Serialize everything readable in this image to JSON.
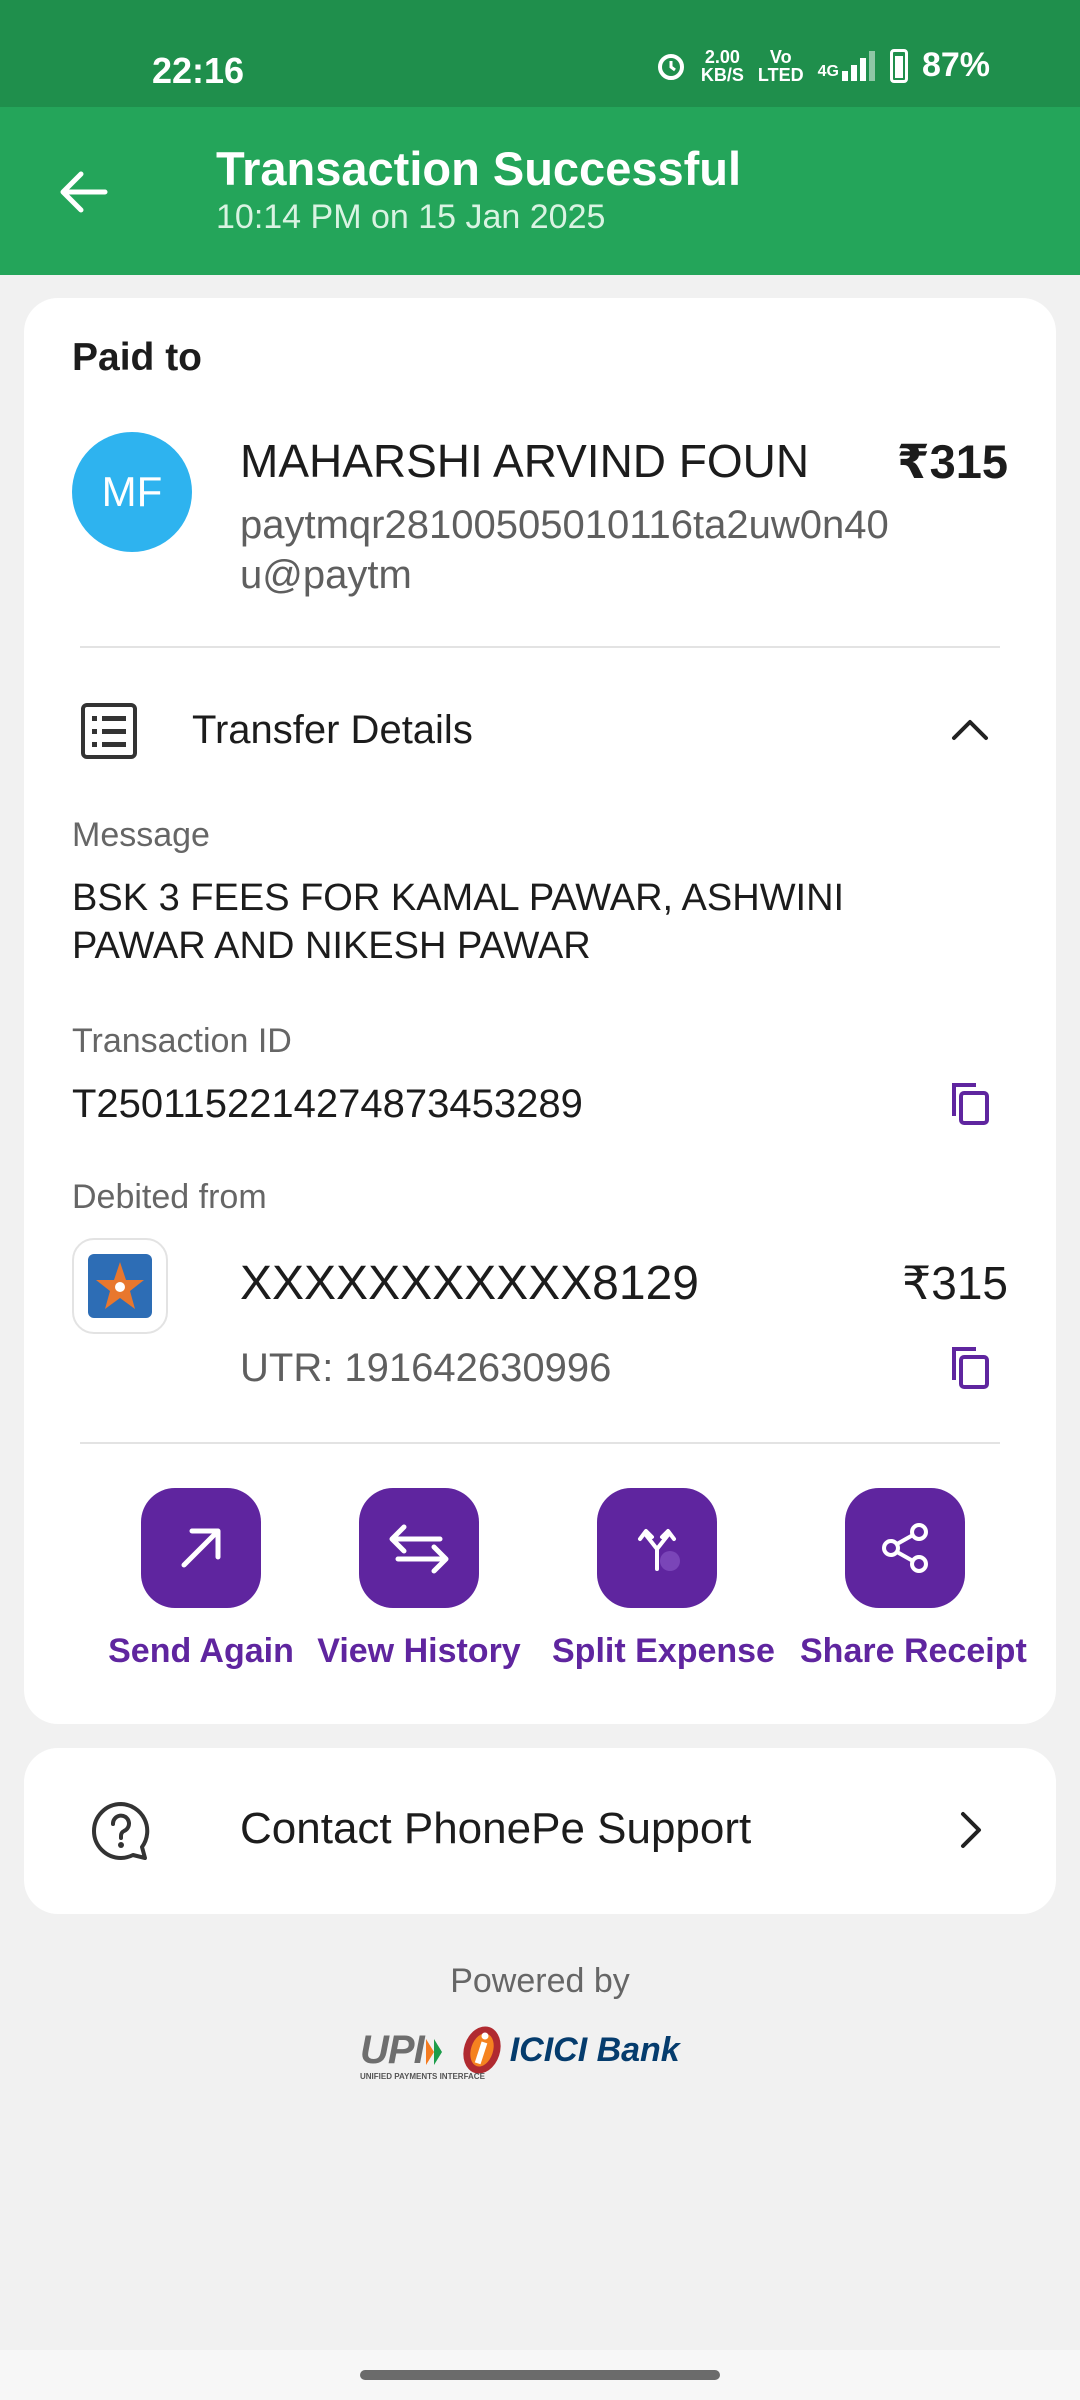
{
  "status_bar": {
    "time": "22:16",
    "net_speed_top": "2.00",
    "net_speed_bottom": "KB/S",
    "volte_top": "Vo",
    "volte_bottom": "LTED",
    "network": "4G",
    "battery": "87%"
  },
  "header": {
    "title": "Transaction Successful",
    "subtitle": "10:14 PM on 15 Jan 2025",
    "back_icon": "arrow-left-icon"
  },
  "payee": {
    "section_label": "Paid to",
    "initials": "MF",
    "name": "MAHARSHI ARVIND FOUN",
    "amount": "₹315",
    "vpa": "paytmqr28100505010116ta2uw0n40u@paytm"
  },
  "transfer_details": {
    "label": "Transfer Details",
    "message_label": "Message",
    "message": "BSK 3 FEES FOR KAMAL PAWAR, ASHWINI PAWAR AND NIKESH PAWAR",
    "txn_id_label": "Transaction ID",
    "txn_id": "T2501152214274873453289",
    "debited_label": "Debited from",
    "account": "XXXXXXXXXXX8129",
    "debit_amount": "₹315",
    "utr": "UTR: 191642630996"
  },
  "actions": [
    {
      "label": "Send Again",
      "icon": "arrow-up-right-icon"
    },
    {
      "label": "View History",
      "icon": "swap-arrows-icon"
    },
    {
      "label": "Split Expense",
      "icon": "split-icon"
    },
    {
      "label": "Share Receipt",
      "icon": "share-icon"
    }
  ],
  "support": {
    "label": "Contact PhonePe Support",
    "icon": "help-bubble-icon"
  },
  "footer": {
    "powered_by": "Powered by",
    "upi_text": "UPI",
    "upi_tagline": "UNIFIED PAYMENTS INTERFACE",
    "bank_name": "ICICI Bank"
  },
  "colors": {
    "status_bar": "#1f8f4c",
    "header": "#24a55a",
    "accent_purple": "#5f259f",
    "avatar": "#2eb3ef"
  }
}
